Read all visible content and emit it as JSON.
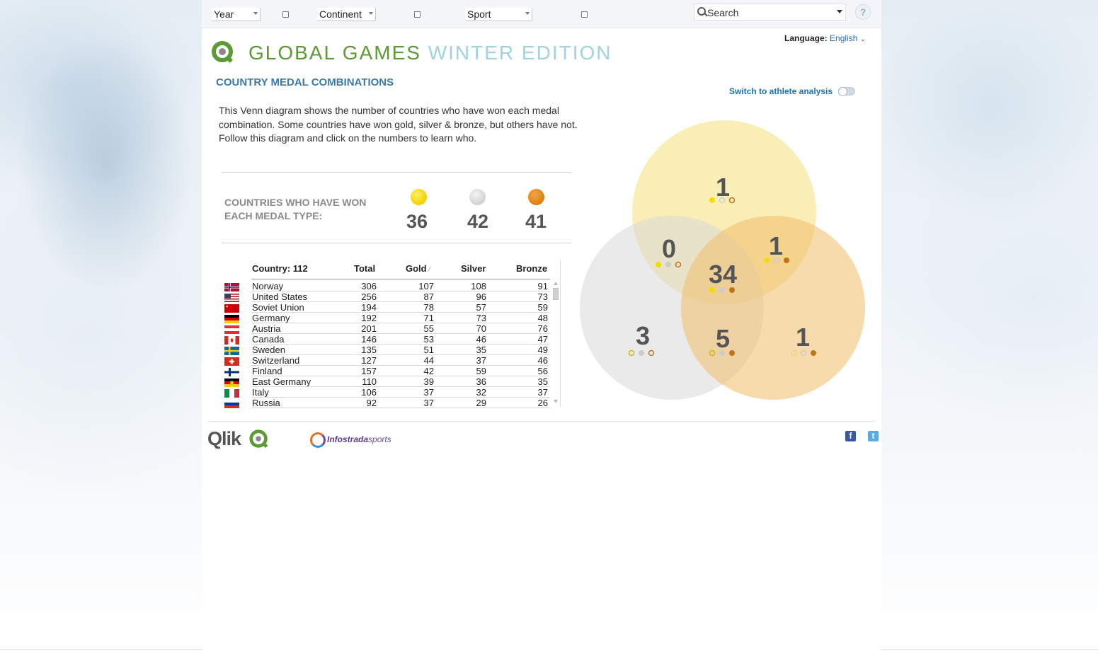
{
  "toolbar": {
    "filters": [
      {
        "label": "Year"
      },
      {
        "label": "Continent"
      },
      {
        "label": "Sport"
      }
    ],
    "search_placeholder": "Search",
    "help_label": "?"
  },
  "language": {
    "label": "Language:",
    "value": "English"
  },
  "brand": {
    "title_part1": "GLOBAL GAMES",
    "title_part2": "WINTER EDITION"
  },
  "section_title": "COUNTRY MEDAL COMBINATIONS",
  "description": "This Venn diagram shows the number of countries who have won each medal combination. Some countries have won gold, silver & bronze, but others have not. Follow this diagram and click on the numbers to learn who.",
  "switch_label": "Switch to athlete analysis",
  "medal_summary": {
    "label": "COUNTRIES WHO HAVE WON EACH MEDAL TYPE:",
    "gold": "36",
    "silver": "42",
    "bronze": "41"
  },
  "table": {
    "headers": {
      "country": "Country: 112",
      "total": "Total",
      "gold": "Gold",
      "silver": "Silver",
      "bronze": "Bronze"
    },
    "rows": [
      {
        "country": "Norway",
        "total": "306",
        "gold": "107",
        "silver": "108",
        "bronze": "91",
        "flag": "norway"
      },
      {
        "country": "United States",
        "total": "256",
        "gold": "87",
        "silver": "96",
        "bronze": "73",
        "flag": "usa"
      },
      {
        "country": "Soviet Union",
        "total": "194",
        "gold": "78",
        "silver": "57",
        "bronze": "59",
        "flag": "ussr"
      },
      {
        "country": "Germany",
        "total": "192",
        "gold": "71",
        "silver": "73",
        "bronze": "48",
        "flag": "germany"
      },
      {
        "country": "Austria",
        "total": "201",
        "gold": "55",
        "silver": "70",
        "bronze": "76",
        "flag": "austria"
      },
      {
        "country": "Canada",
        "total": "146",
        "gold": "53",
        "silver": "46",
        "bronze": "47",
        "flag": "canada"
      },
      {
        "country": "Sweden",
        "total": "135",
        "gold": "51",
        "silver": "35",
        "bronze": "49",
        "flag": "sweden"
      },
      {
        "country": "Switzerland",
        "total": "127",
        "gold": "44",
        "silver": "37",
        "bronze": "46",
        "flag": "switzerland"
      },
      {
        "country": "Finland",
        "total": "157",
        "gold": "42",
        "silver": "59",
        "bronze": "56",
        "flag": "finland"
      },
      {
        "country": "East Germany",
        "total": "110",
        "gold": "39",
        "silver": "36",
        "bronze": "35",
        "flag": "east-germany"
      },
      {
        "country": "Italy",
        "total": "106",
        "gold": "37",
        "silver": "32",
        "bronze": "37",
        "flag": "italy"
      },
      {
        "country": "Russia",
        "total": "92",
        "gold": "37",
        "silver": "29",
        "bronze": "26",
        "flag": "russia"
      }
    ]
  },
  "venn": {
    "gold_only": "1",
    "gold_silver": "0",
    "gold_bronze": "1",
    "all_three": "34",
    "silver_only": "3",
    "silver_bronze": "5",
    "bronze_only": "1",
    "colors": {
      "gold": "#f7e48a",
      "silver": "#d8d8d8",
      "bronze": "#f0bd6a"
    }
  },
  "footer": {
    "qlik": "Qlik",
    "partner_a": "Infostrada",
    "partner_b": "sports",
    "facebook": "f",
    "twitter": "t"
  }
}
